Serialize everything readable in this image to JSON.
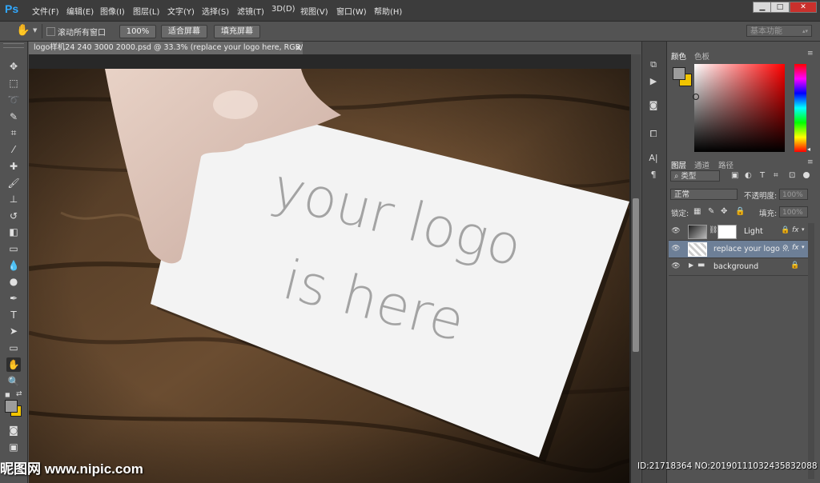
{
  "menubar": {
    "logo": "Ps",
    "items": [
      "文件(F)",
      "编辑(E)",
      "图像(I)",
      "图层(L)",
      "文字(Y)",
      "选择(S)",
      "滤镜(T)",
      "3D(D)",
      "视图(V)",
      "窗口(W)",
      "帮助(H)"
    ],
    "window_buttons": [
      "▁",
      "□",
      "✕"
    ]
  },
  "options": {
    "scroll_all_label": "滚动所有窗口",
    "zoom_100_label": "100%",
    "fit_screen_label": "适合屏幕",
    "fill_screen_label": "填充屏幕",
    "workspace": "基本功能"
  },
  "document": {
    "tab_title": "logo样机24 240 3000 2000.psd @ 33.3% (replace your logo here, RGB/8*) *",
    "close_glyph": "×",
    "card_text_line1": "your logo",
    "card_text_line2": "is here"
  },
  "color_panel": {
    "tabs": [
      "颜色",
      "色板"
    ],
    "accent_foreground": "#9c9c9c",
    "accent_background": "#f2c500"
  },
  "layers_panel": {
    "tabs": [
      "图层",
      "通道",
      "路径"
    ],
    "filter_label": "类型",
    "blend_mode": "正常",
    "opacity_label": "不透明度:",
    "opacity_value": "100%",
    "lock_label": "锁定:",
    "fill_label": "填充:",
    "fill_value": "100%",
    "layers": [
      {
        "name": "Light",
        "selected": false
      },
      {
        "name": "replace your logo ...",
        "selected": true
      },
      {
        "name": "background",
        "selected": false
      }
    ]
  },
  "watermark": {
    "text": "昵图网 www.nipic.com",
    "id_stamp": "ID:21718364 NO:20190111032435832088"
  }
}
